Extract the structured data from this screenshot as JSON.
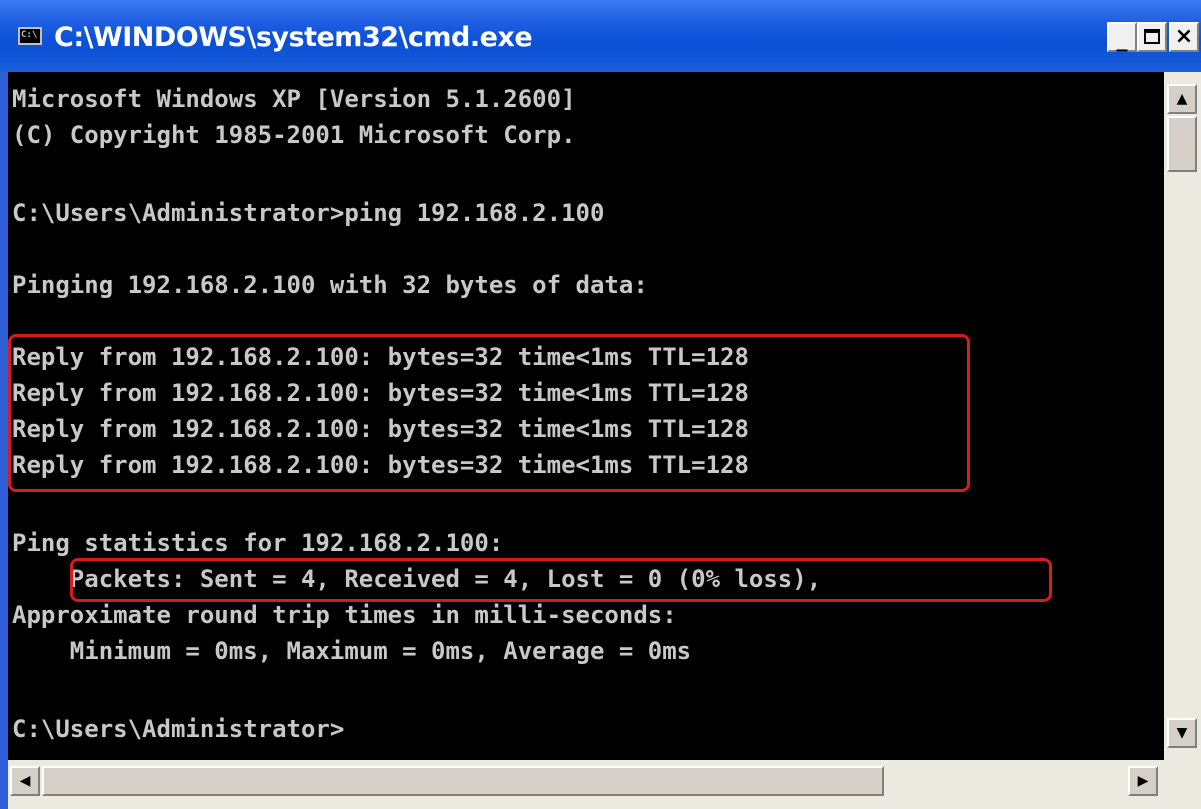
{
  "window": {
    "title": "C:\\WINDOWS\\system32\\cmd.exe",
    "icon": "console-icon",
    "icon_text": "C:\\",
    "minimize_label": "_",
    "close_label": "×"
  },
  "console": {
    "lines": [
      "Microsoft Windows XP [Version 5.1.2600]",
      "(C) Copyright 1985-2001 Microsoft Corp.",
      "",
      "C:\\Users\\Administrator>ping 192.168.2.100",
      "",
      "Pinging 192.168.2.100 with 32 bytes of data:",
      "",
      "Reply from 192.168.2.100: bytes=32 time<1ms TTL=128",
      "Reply from 192.168.2.100: bytes=32 time<1ms TTL=128",
      "Reply from 192.168.2.100: bytes=32 time<1ms TTL=128",
      "Reply from 192.168.2.100: bytes=32 time<1ms TTL=128",
      "",
      "Ping statistics for 192.168.2.100:",
      "    Packets: Sent = 4, Received = 4, Lost = 0 (0% loss),",
      "Approximate round trip times in milli-seconds:",
      "    Minimum = 0ms, Maximum = 0ms, Average = 0ms",
      "",
      "C:\\Users\\Administrator>"
    ],
    "text_color": "#c8c8c8",
    "background_color": "#000000",
    "highlight_color": "#d11f1f"
  },
  "scrollbars": {
    "up_arrow": "▲",
    "down_arrow": "▼",
    "left_arrow": "◀",
    "right_arrow": "▶"
  }
}
